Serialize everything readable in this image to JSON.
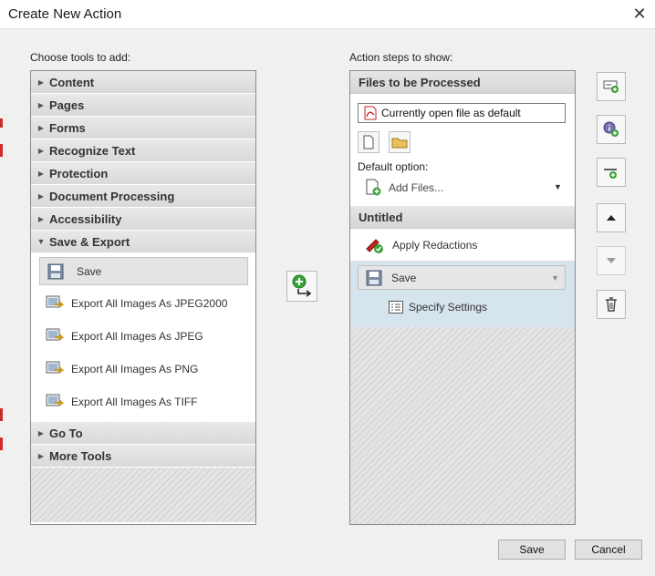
{
  "window": {
    "title": "Create New Action",
    "close": "✕"
  },
  "left": {
    "caption": "Choose tools to add:",
    "categories_top": [
      {
        "label": "Content"
      },
      {
        "label": "Pages"
      },
      {
        "label": "Forms"
      },
      {
        "label": "Recognize Text"
      },
      {
        "label": "Protection"
      },
      {
        "label": "Document Processing"
      },
      {
        "label": "Accessibility"
      }
    ],
    "open_category": {
      "label": "Save & Export"
    },
    "tools": [
      {
        "label": "Save",
        "icon": "save-icon",
        "selected": true
      },
      {
        "label": "Export All Images As JPEG2000",
        "icon": "export-image-icon"
      },
      {
        "label": "Export All Images As JPEG",
        "icon": "export-image-icon"
      },
      {
        "label": "Export All Images As PNG",
        "icon": "export-image-icon"
      },
      {
        "label": "Export All Images As TIFF",
        "icon": "export-image-icon"
      }
    ],
    "categories_bottom": [
      {
        "label": "Go To"
      },
      {
        "label": "More Tools"
      }
    ]
  },
  "right": {
    "caption": "Action steps to show:",
    "files_header": "Files to be Processed",
    "file_field": "Currently open file as default",
    "default_option_label": "Default option:",
    "add_files": "Add Files...",
    "untitled_header": "Untitled",
    "steps": {
      "apply_redactions": "Apply Redactions",
      "save": "Save",
      "specify_settings": "Specify Settings"
    }
  },
  "footer": {
    "save": "Save",
    "cancel": "Cancel"
  },
  "colors": {
    "selected_step_bg": "#d6e4ee",
    "pdf_red": "#c8231f",
    "add_green": "#3aa23a"
  }
}
